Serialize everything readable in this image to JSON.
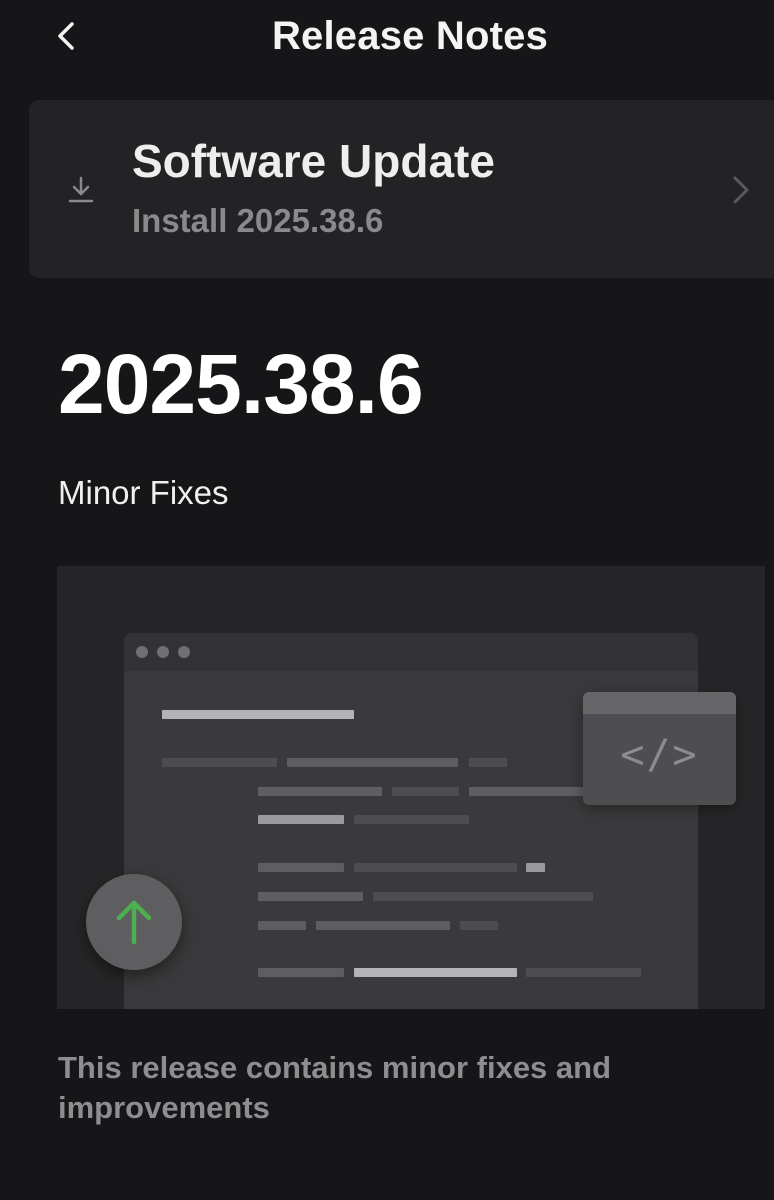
{
  "header": {
    "back_icon": "chevron-left-icon",
    "title": "Release Notes"
  },
  "update_card": {
    "icon": "download-icon",
    "title": "Software Update",
    "subtitle": "Install 2025.38.6",
    "chevron_icon": "chevron-right-icon"
  },
  "release": {
    "version": "2025.38.6",
    "heading": "Minor Fixes",
    "illustration_icons": [
      "code-icon",
      "arrow-up-icon"
    ],
    "illustration_code_glyph": "</>",
    "description": "This release contains minor fixes and improvements"
  },
  "colors": {
    "background": "#161618",
    "card": "#232325",
    "accent_green": "#4caf50",
    "muted_text": "#8e8e90"
  }
}
